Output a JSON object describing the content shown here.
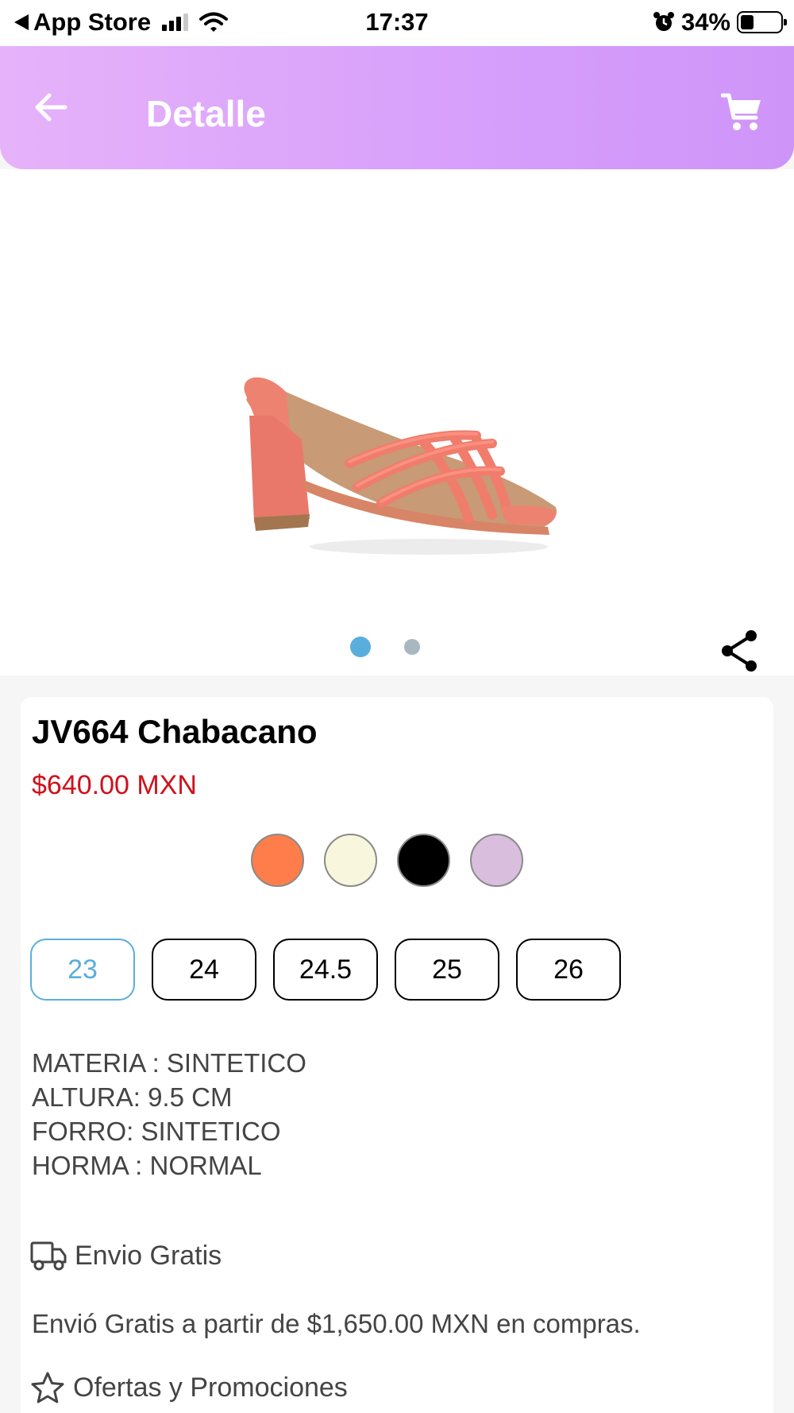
{
  "status_bar": {
    "back_app": "App Store",
    "time": "17:37",
    "battery_percent": "34%",
    "battery_level": 0.34
  },
  "header": {
    "title": "Detalle",
    "icons": {
      "back": "arrow-left-icon",
      "cart": "shopping-cart-icon"
    }
  },
  "gallery": {
    "image": "coral-strappy-block-heel-sandal",
    "total_images": 2,
    "active_index": 0,
    "share_icon": "share-icon"
  },
  "product": {
    "name": "JV664 Chabacano",
    "price": "$640.00 MXN",
    "colors": [
      {
        "name": "coral",
        "hex": "#ff7d4b"
      },
      {
        "name": "cream",
        "hex": "#f8f6dc"
      },
      {
        "name": "black",
        "hex": "#000000"
      },
      {
        "name": "lilac",
        "hex": "#d9bedd"
      }
    ],
    "sizes": [
      {
        "label": "23",
        "selected": true
      },
      {
        "label": "24",
        "selected": false
      },
      {
        "label": "24.5",
        "selected": false
      },
      {
        "label": "25",
        "selected": false
      },
      {
        "label": "26",
        "selected": false
      }
    ],
    "specs": [
      "MATERIA : SINTETICO",
      "ALTURA: 9.5 CM",
      "FORRO: SINTETICO",
      "HORMA : NORMAL"
    ]
  },
  "shipping": {
    "label": "Envio Gratis",
    "note": "Envió Gratis a partir de $1,650.00 MXN en compras."
  },
  "promotions": {
    "label": "Ofertas y Promociones"
  },
  "colors": {
    "header_gradient_start": "#e6b2fa",
    "header_gradient_end": "#cf94f8",
    "price_red": "#d0101a",
    "accent_blue": "#5aaedc"
  }
}
